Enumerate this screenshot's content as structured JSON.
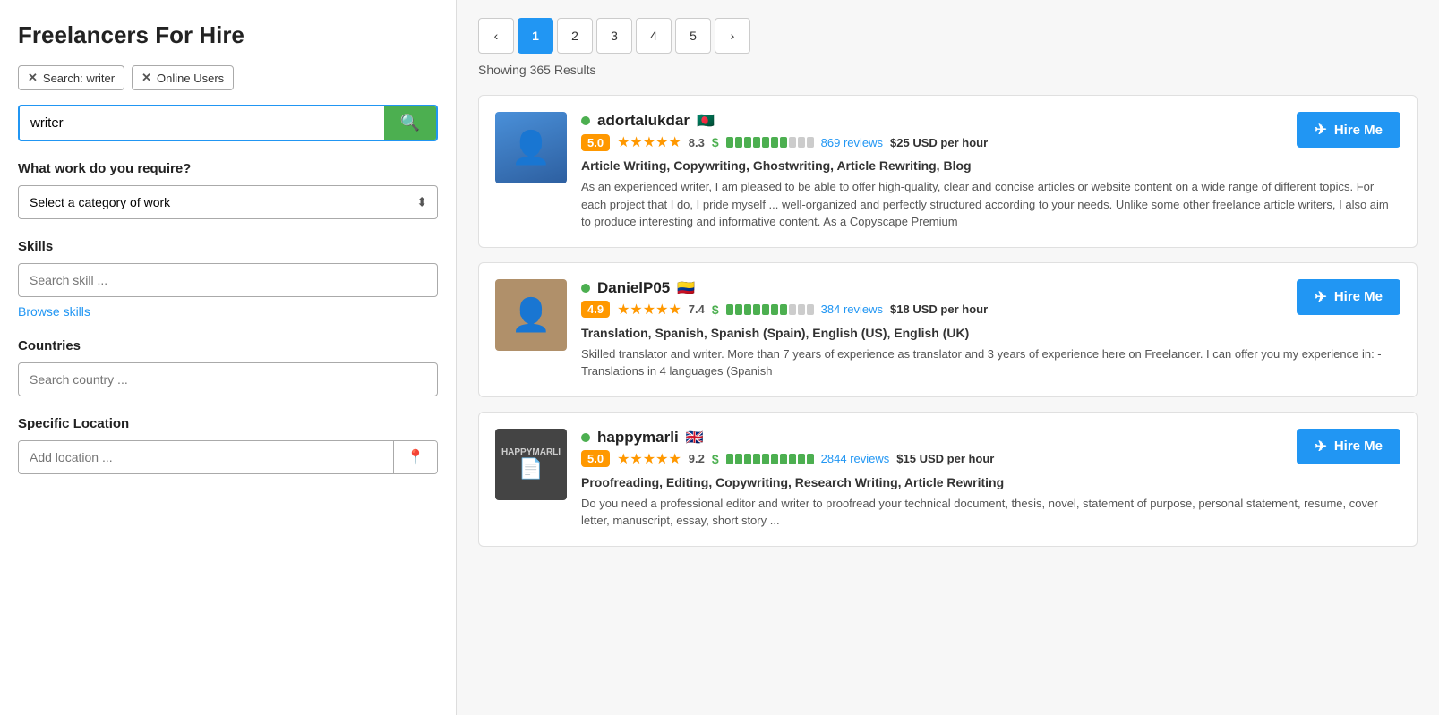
{
  "sidebar": {
    "title": "Freelancers For Hire",
    "filter_tags": [
      {
        "id": "search-tag",
        "label": "Search: writer"
      },
      {
        "id": "online-tag",
        "label": "Online Users"
      }
    ],
    "search_input": {
      "value": "writer",
      "placeholder": "writer"
    },
    "work_section": {
      "label": "What work do you require?",
      "select_placeholder": "Select a category of work"
    },
    "skills_section": {
      "label": "Skills",
      "input_placeholder": "Search skill ...",
      "browse_label": "Browse skills"
    },
    "countries_section": {
      "label": "Countries",
      "input_placeholder": "Search country ..."
    },
    "location_section": {
      "label": "Specific Location",
      "input_placeholder": "Add location ..."
    }
  },
  "main": {
    "pagination": {
      "pages": [
        "1",
        "2",
        "3",
        "4",
        "5"
      ],
      "active": "1",
      "prev": "‹",
      "next": "›"
    },
    "results_count": "Showing 365 Results",
    "freelancers": [
      {
        "id": "adortalukdar",
        "name": "adortalukdar",
        "flag": "🇧🇩",
        "online": true,
        "rating": "5.0",
        "stars": 5,
        "score": "8.3",
        "earnings_filled": 7,
        "earnings_total": 10,
        "reviews_count": "869 reviews",
        "price": "$25 USD per hour",
        "hire_label": "Hire Me",
        "skills": "Article Writing, Copywriting, Ghostwriting, Article Rewriting, Blog",
        "description": "As an experienced writer, I am pleased to be able to offer high-quality, clear and concise articles or website content on a wide range of different topics. For each project that I do, I pride myself ... well-organized and perfectly structured according to your needs. Unlike some other freelance article writers, I also aim to produce interesting and informative content. As a Copyscape Premium",
        "avatar_type": "person",
        "avatar_color": "#3a7bd5"
      },
      {
        "id": "danielp05",
        "name": "DanielP05",
        "flag": "🇨🇴",
        "online": true,
        "rating": "4.9",
        "stars": 5,
        "score": "7.4",
        "earnings_filled": 7,
        "earnings_total": 10,
        "reviews_count": "384 reviews",
        "price": "$18 USD per hour",
        "hire_label": "Hire Me",
        "skills": "Translation, Spanish, Spanish (Spain), English (US), English (UK)",
        "description": "Skilled translator and writer. More than 7 years of experience as translator and 3 years of experience here on Freelancer. I can offer you my experience in: - Translations in 4 languages (Spanish",
        "avatar_type": "person",
        "avatar_color": "#a08070"
      },
      {
        "id": "happymarli",
        "name": "happymarli",
        "flag": "🇬🇧",
        "online": true,
        "rating": "5.0",
        "stars": 5,
        "score": "9.2",
        "earnings_filled": 10,
        "earnings_total": 10,
        "reviews_count": "2844 reviews",
        "price": "$15 USD per hour",
        "hire_label": "Hire Me",
        "skills": "Proofreading, Editing, Copywriting, Research Writing, Article Rewriting",
        "description": "Do you need a professional editor and writer to proofread your technical document, thesis, novel, statement of purpose, personal statement, resume, cover letter, manuscript, essay, short story ...",
        "avatar_type": "logo",
        "avatar_color": "#444"
      }
    ]
  },
  "icons": {
    "search": "🔍",
    "bird": "✈",
    "pin": "📍",
    "x": "✕"
  }
}
